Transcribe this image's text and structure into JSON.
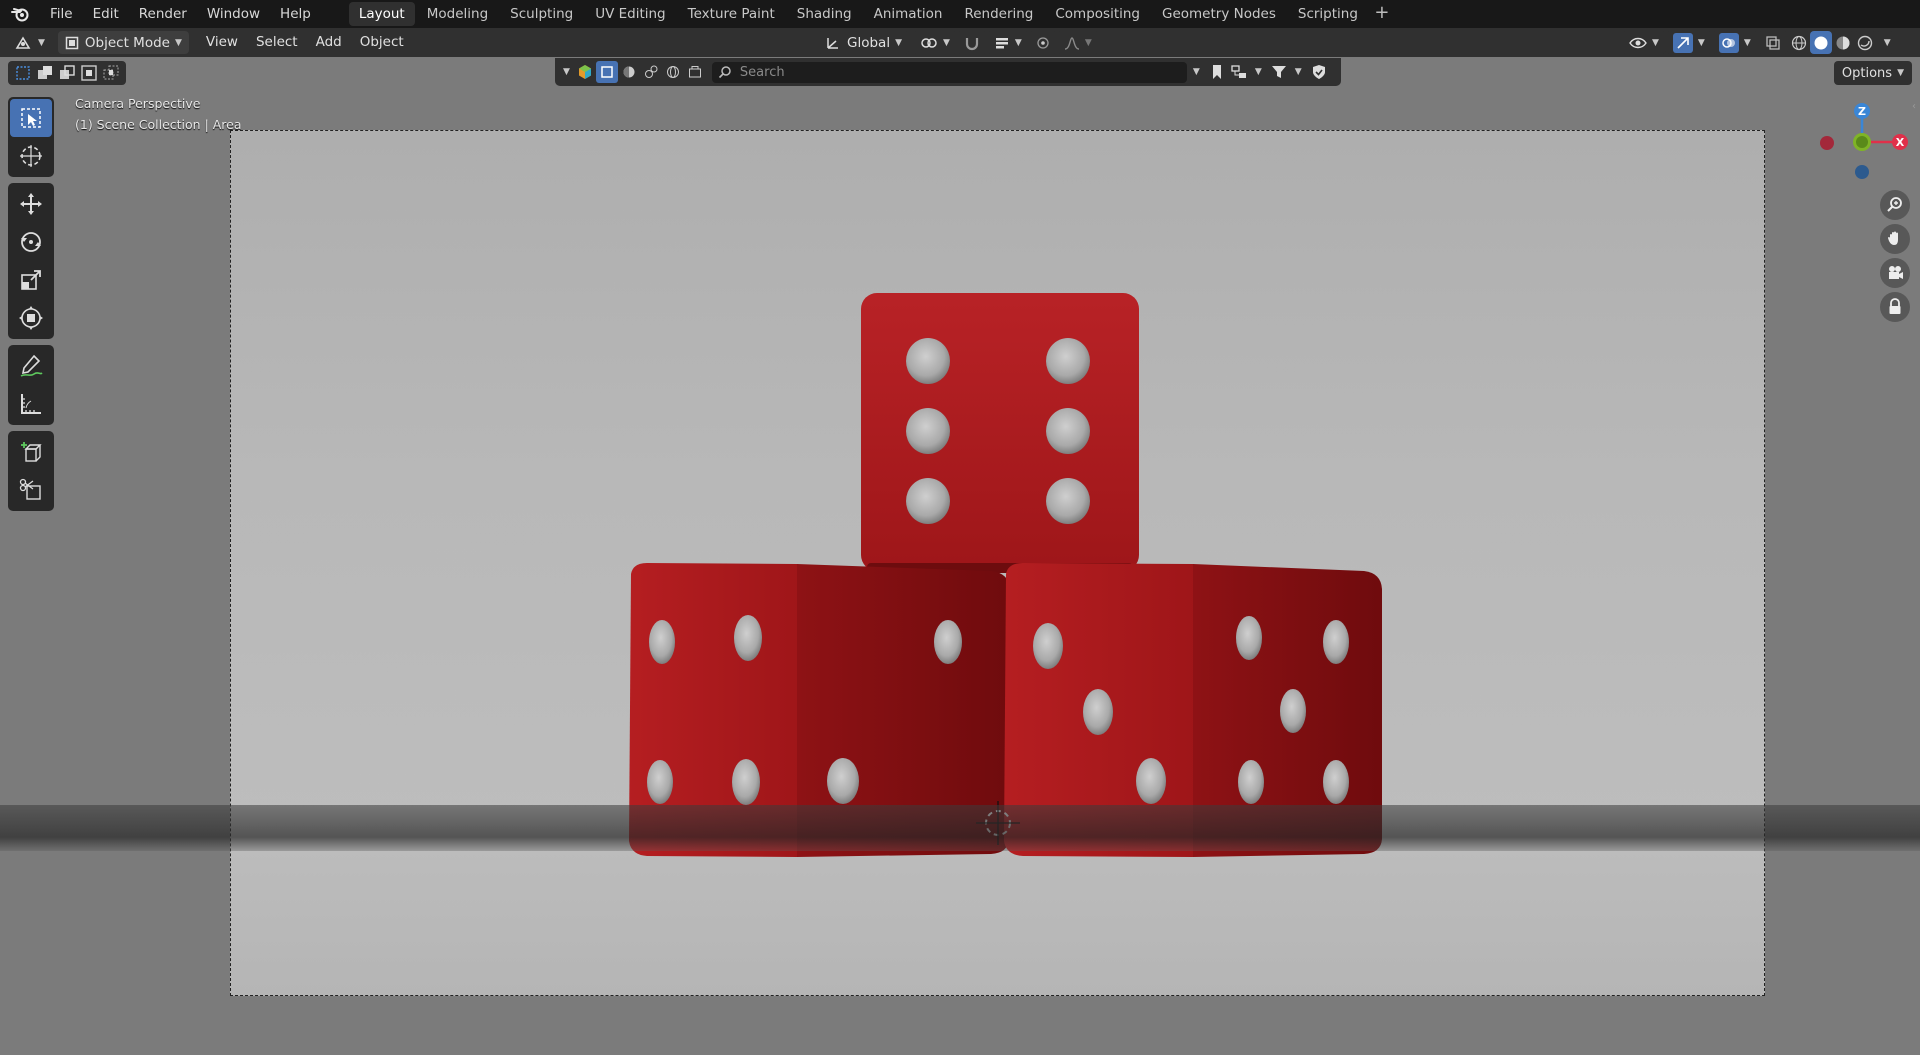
{
  "menu": {
    "items": [
      "File",
      "Edit",
      "Render",
      "Window",
      "Help"
    ]
  },
  "workspaces": {
    "tabs": [
      "Layout",
      "Modeling",
      "Sculpting",
      "UV Editing",
      "Texture Paint",
      "Shading",
      "Animation",
      "Rendering",
      "Compositing",
      "Geometry Nodes",
      "Scripting"
    ],
    "active": "Layout",
    "add_label": "+"
  },
  "header": {
    "mode": "Object Mode",
    "menus": [
      "View",
      "Select",
      "Add",
      "Object"
    ],
    "orientation": "Global"
  },
  "outliner": {
    "search_placeholder": "Search"
  },
  "viewport": {
    "perspective_label": "Camera Perspective",
    "collection_label": "(1) Scene Collection | Area",
    "options_label": "Options"
  },
  "gizmo": {
    "z": "Z",
    "x": "X"
  },
  "toolbar": {
    "tools": [
      "select-box",
      "cursor",
      "move",
      "rotate",
      "scale",
      "transform",
      "annotate",
      "measure",
      "add-cube",
      "knife"
    ],
    "active": "select-box"
  },
  "colors": {
    "accent": "#4772b3",
    "die_red": "#b3191c",
    "axis_x": "#e0304a",
    "axis_y": "#7fb426",
    "axis_z": "#3a86d6"
  }
}
